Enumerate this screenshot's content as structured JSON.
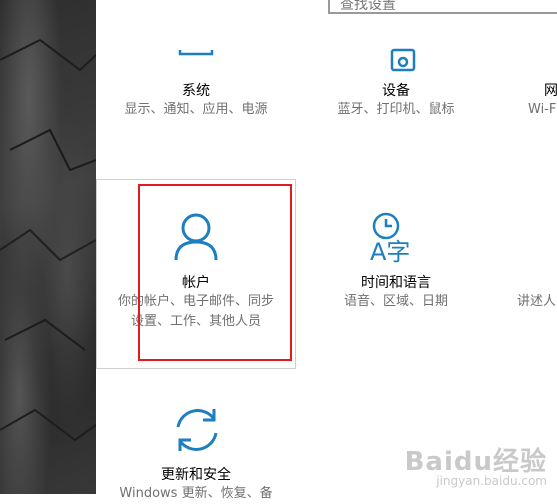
{
  "search": {
    "placeholder_text": "查找设置"
  },
  "tiles": {
    "system": {
      "title": "系统",
      "desc": "显示、通知、应用、电源"
    },
    "devices": {
      "title": "设备",
      "desc": "蓝牙、打印机、鼠标"
    },
    "network": {
      "title": "网",
      "desc": "Wi-F"
    },
    "accounts": {
      "title": "帐户",
      "desc1": "你的帐户、电子邮件、同步",
      "desc2": "设置、工作、其他人员"
    },
    "time_language": {
      "title": "时间和语言",
      "desc": "语音、区域、日期",
      "glyph": "A字"
    },
    "ease": {
      "desc": "讲述人"
    },
    "update": {
      "title": "更新和安全",
      "desc": "Windows 更新、恢复、备"
    }
  },
  "watermark": {
    "logo": "Baidu经验",
    "sub": "jingyan.baidu.com"
  },
  "colors": {
    "accent": "#1e7fc0",
    "highlight": "#e41b1b"
  }
}
